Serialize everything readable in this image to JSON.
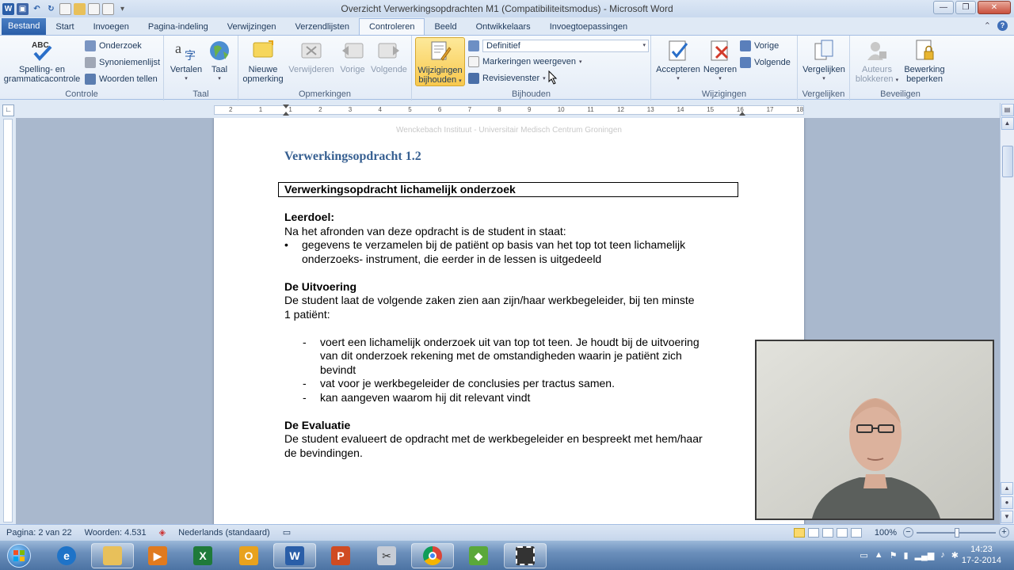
{
  "window": {
    "title": "Overzicht Verwerkingsopdrachten M1 (Compatibiliteitsmodus)  -  Microsoft Word"
  },
  "tabs": [
    "Bestand",
    "Start",
    "Invoegen",
    "Pagina-indeling",
    "Verwijzingen",
    "Verzendlijsten",
    "Controleren",
    "Beeld",
    "Ontwikkelaars",
    "Invoegtoepassingen"
  ],
  "active_tab": "Controleren",
  "ribbon": {
    "controle": {
      "label": "Controle",
      "spelling": "Spelling- en grammaticacontrole",
      "spelling_line1": "Spelling- en",
      "spelling_line2": "grammaticacontrole",
      "onderzoek": "Onderzoek",
      "synoniemen": "Synoniemenlijst",
      "woorden": "Woorden tellen"
    },
    "taal": {
      "label": "Taal",
      "vertalen": "Vertalen",
      "taal": "Taal"
    },
    "opmerkingen": {
      "label": "Opmerkingen",
      "nieuwe_line1": "Nieuwe",
      "nieuwe_line2": "opmerking",
      "verwijderen": "Verwijderen",
      "vorige": "Vorige",
      "volgende": "Volgende"
    },
    "bijhouden": {
      "label": "Bijhouden",
      "wijzigingen_line1": "Wijzigingen",
      "wijzigingen_line2": "bijhouden",
      "definitief": "Definitief",
      "markeringen": "Markeringen weergeven",
      "revisievenster": "Revisievenster"
    },
    "wijzigingen": {
      "label": "Wijzigingen",
      "accepteren": "Accepteren",
      "negeren": "Negeren",
      "vorige": "Vorige",
      "volgende": "Volgende"
    },
    "vergelijken": {
      "label": "Vergelijken",
      "vergelijken": "Vergelijken"
    },
    "beveiligen": {
      "label": "Beveiligen",
      "auteurs_line1": "Auteurs",
      "auteurs_line2": "blokkeren",
      "bewerking_line1": "Bewerking",
      "bewerking_line2": "beperken"
    }
  },
  "ruler": {
    "ticks": [
      "2",
      "1",
      "1",
      "2",
      "3",
      "4",
      "5",
      "6",
      "7",
      "8",
      "9",
      "10",
      "11",
      "12",
      "13",
      "14",
      "15",
      "16",
      "17",
      "18"
    ]
  },
  "document": {
    "header": "Wenckebach Instituut - Universitair Medisch Centrum Groningen",
    "title": "Verwerkingsopdracht 1.2",
    "boxed_heading": "Verwerkingsopdracht lichamelijk  onderzoek",
    "leerdoel_heading": "Leerdoel:",
    "leerdoel_text": "Na het afronden van deze opdracht is de student in staat:",
    "bullet_symbol": "•",
    "leerdoel_bullet_1": "gegevens te verzamelen bij de patiënt op basis van het top tot teen lichamelijk",
    "leerdoel_bullet_2": "onderzoeks- instrument, die eerder in de lessen is uitgedeeld",
    "uitvoering_heading": "De Uitvoering",
    "uitvoering_line1": "De student laat de volgende zaken zien aan zijn/haar werkbegeleider, bij ten minste",
    "uitvoering_line2": "1 patiënt:",
    "dash": "-",
    "item1_line1": "voert een lichamelijk onderzoek uit van top tot teen. Je houdt bij de uitvoering",
    "item1_line2": "van dit onderzoek rekening met de omstandigheden waarin je patiënt zich",
    "item1_line3": "bevindt",
    "item2": "vat voor je werkbegeleider de conclusies per tractus samen.",
    "item3": "kan aangeven waarom hij dit relevant vindt",
    "evaluatie_heading": "De Evaluatie",
    "evaluatie_line1": "De student evalueert de opdracht met de werkbegeleider en bespreekt met hem/haar",
    "evaluatie_line2": "de bevindingen."
  },
  "statusbar": {
    "pagina": "Pagina: 2 van 22",
    "woorden": "Woorden: 4.531",
    "taal": "Nederlands (standaard)",
    "zoom": "100%"
  },
  "taskbar": {
    "time": "14:23",
    "date": "17-2-2014"
  },
  "colors": {
    "ribbon_accent": "#2a5ea8",
    "title_blue": "#365f91",
    "active_highlight": "#fbd96c"
  }
}
